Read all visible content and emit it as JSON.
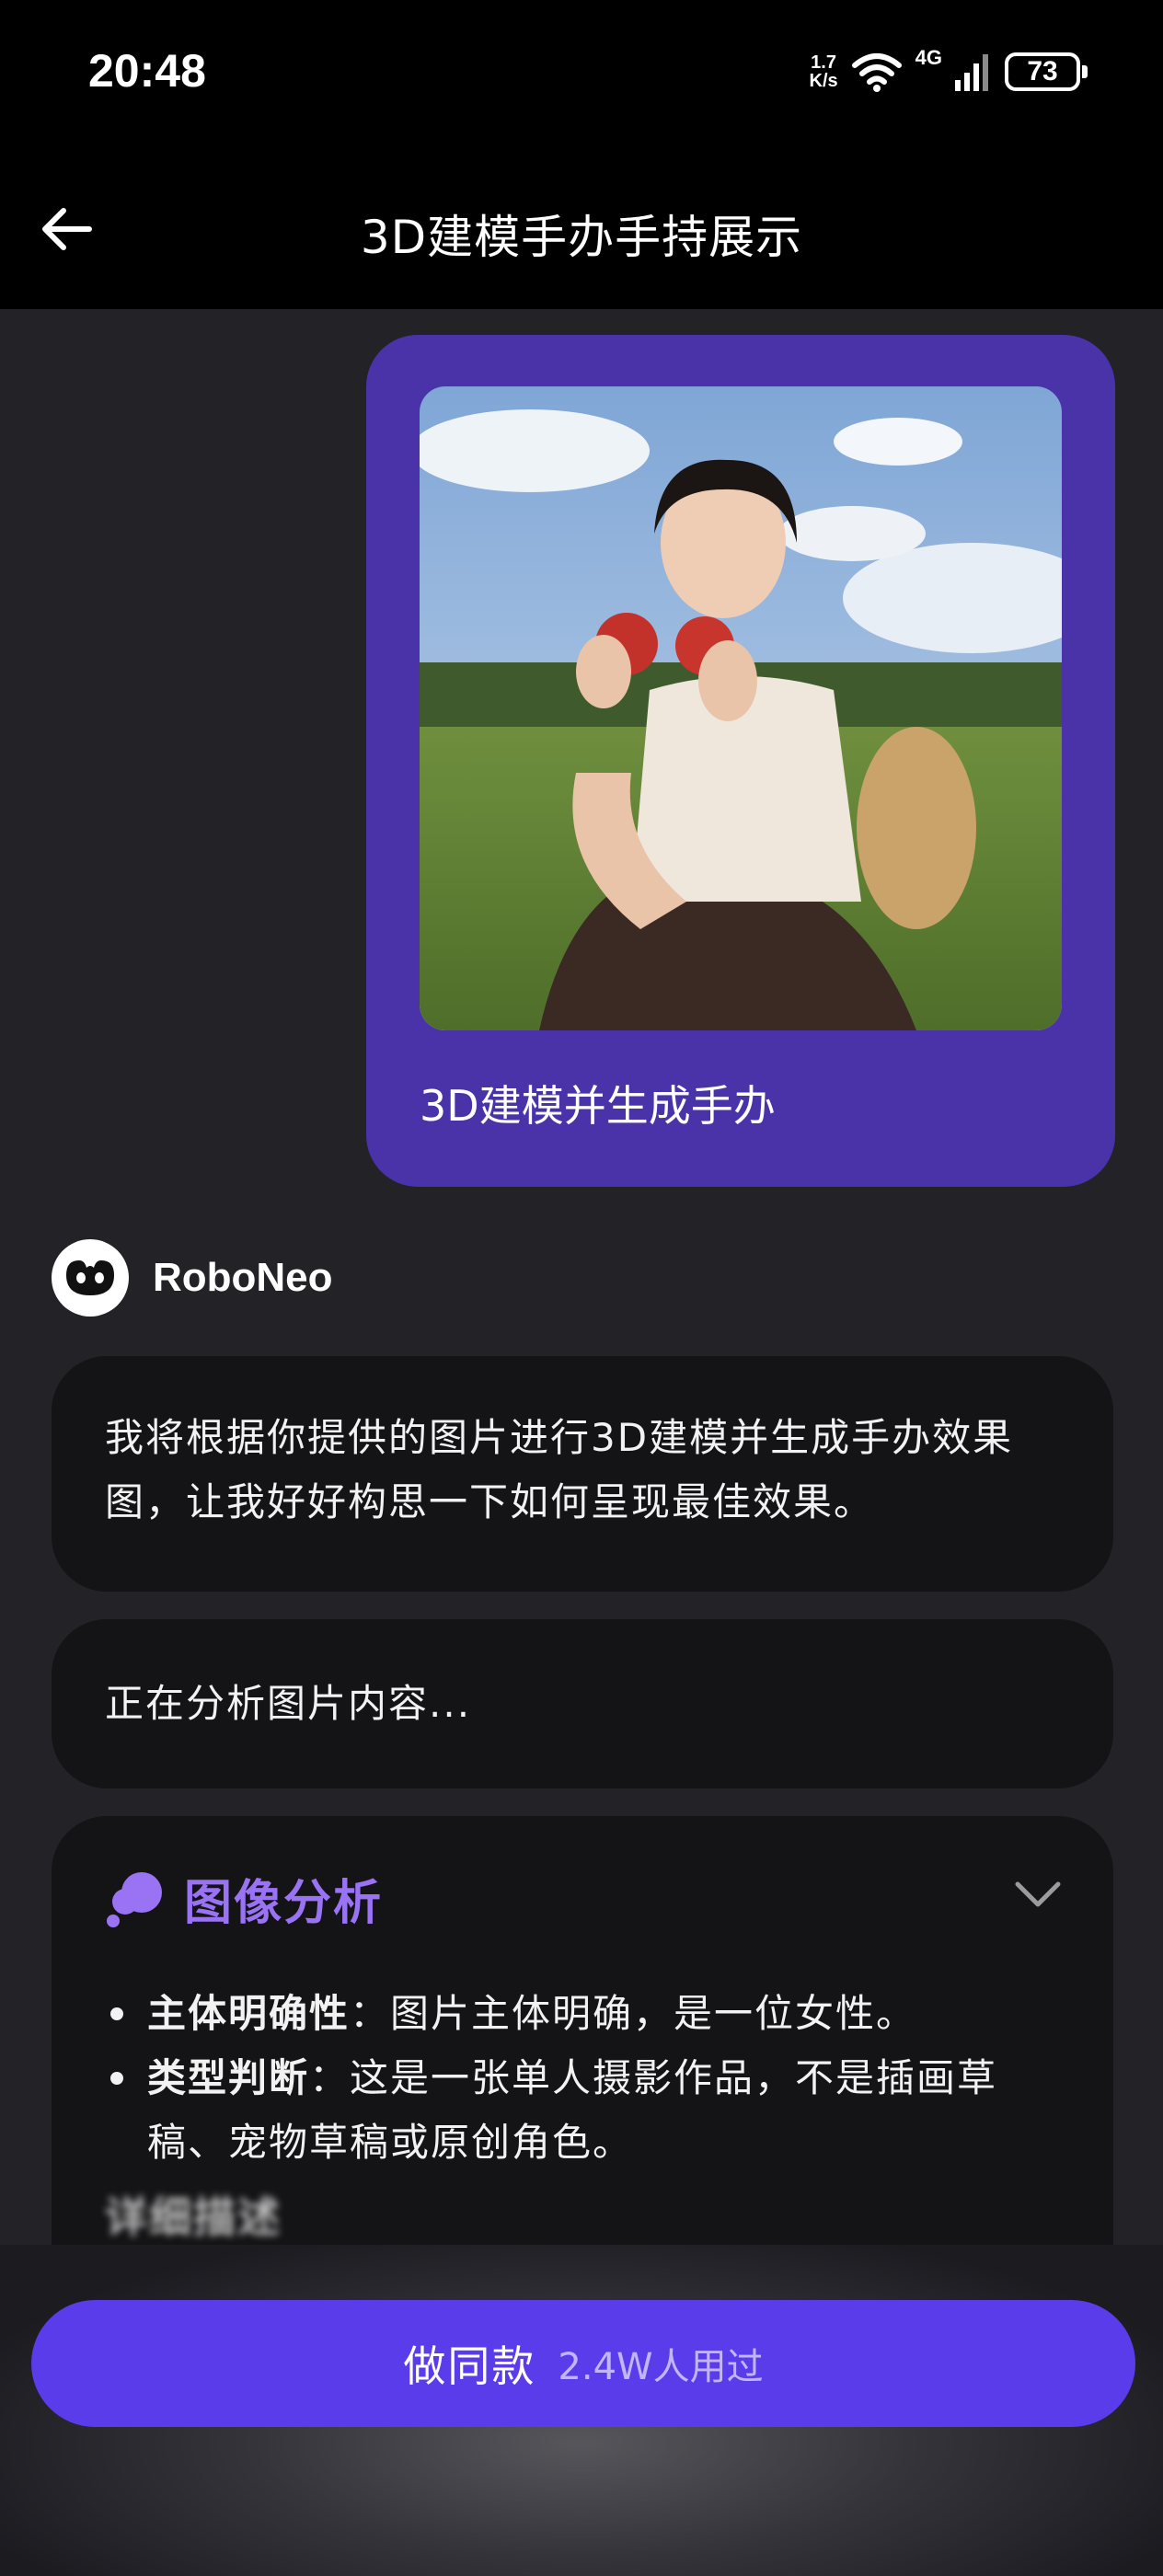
{
  "status_bar": {
    "time": "20:48",
    "net_speed_value": "1.7",
    "net_speed_unit": "K/s",
    "network": "4G",
    "battery": "73"
  },
  "header": {
    "title": "3D建模手办手持展示"
  },
  "user_message": {
    "text": "3D建模并生成手办"
  },
  "bot": {
    "name": "RoboNeo",
    "reply": "我将根据你提供的图片进行3D建模并生成手办效果图，让我好好构思一下如何呈现最佳效果。",
    "status": "正在分析图片内容...",
    "analysis": {
      "title": "图像分析",
      "items": [
        {
          "key": "主体明确性",
          "value": "：图片主体明确，是一位女性。"
        },
        {
          "key": "类型判断",
          "value": "：这是一张单人摄影作品，不是插画草稿、宠物草稿或原创角色。"
        }
      ],
      "next_heading": "详细描述"
    }
  },
  "cta": {
    "label": "做同款",
    "count": "2.4W人用过"
  },
  "colors": {
    "accent": "#5b3cea",
    "user_bubble": "#4a33a8",
    "analysis_title": "#9a73f5",
    "card_bg": "#141416",
    "page_bg": "#232227"
  }
}
